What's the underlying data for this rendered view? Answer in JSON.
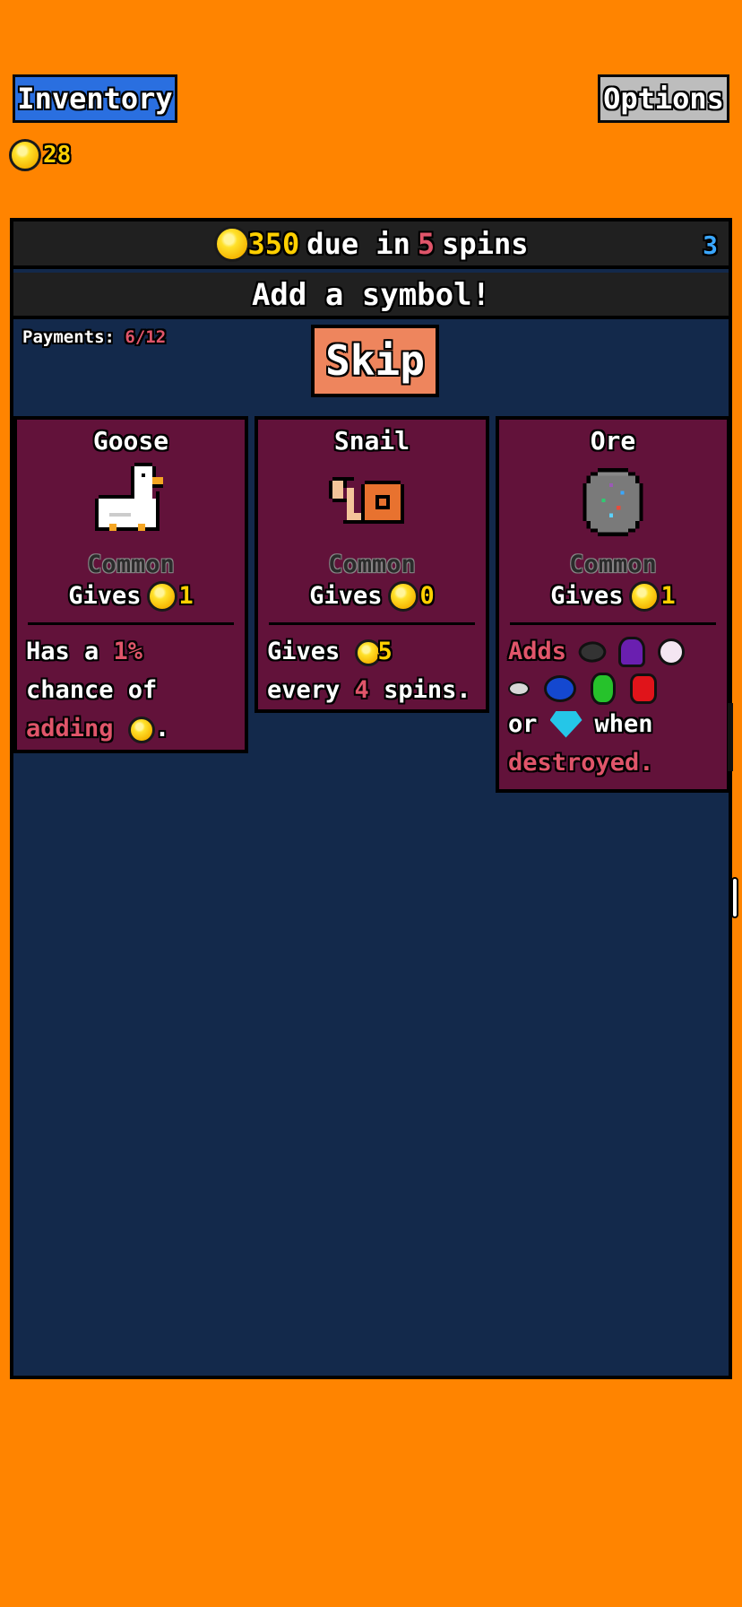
{
  "header": {
    "inventory_label": "Inventory",
    "options_label": "Options",
    "coins": "28"
  },
  "due_bar": {
    "amount": "350",
    "due_in": "due in",
    "spins_count": "5",
    "spins_word": "spins",
    "right_count": "3"
  },
  "add_bar": {
    "label": "Add a symbol!"
  },
  "payments": {
    "label": "Payments:",
    "value": "6/12"
  },
  "skip": {
    "label": "Skip"
  },
  "cards": [
    {
      "name": "Goose",
      "rarity": "Common",
      "gives_label": "Gives",
      "gives_value": "1",
      "desc": {
        "l1a": "Has a",
        "l1b": "1%",
        "l2": "chance of",
        "l3a": "adding",
        "l3b": "."
      }
    },
    {
      "name": "Snail",
      "rarity": "Common",
      "gives_label": "Gives",
      "gives_value": "0",
      "desc": {
        "l1a": "Gives",
        "l1b": "5",
        "l2a": "every",
        "l2b": "4",
        "l2c": "spins."
      }
    },
    {
      "name": "Ore",
      "rarity": "Common",
      "gives_label": "Gives",
      "gives_value": "1",
      "desc": {
        "l1a": "Adds",
        "l3a": "or",
        "l3b": "when",
        "l4": "destroyed."
      }
    }
  ],
  "colors": {
    "background": "#ff8400",
    "panel": "#13294b",
    "card": "#62123a",
    "accent_red": "#e0556a",
    "coin_text": "#ffd000"
  }
}
